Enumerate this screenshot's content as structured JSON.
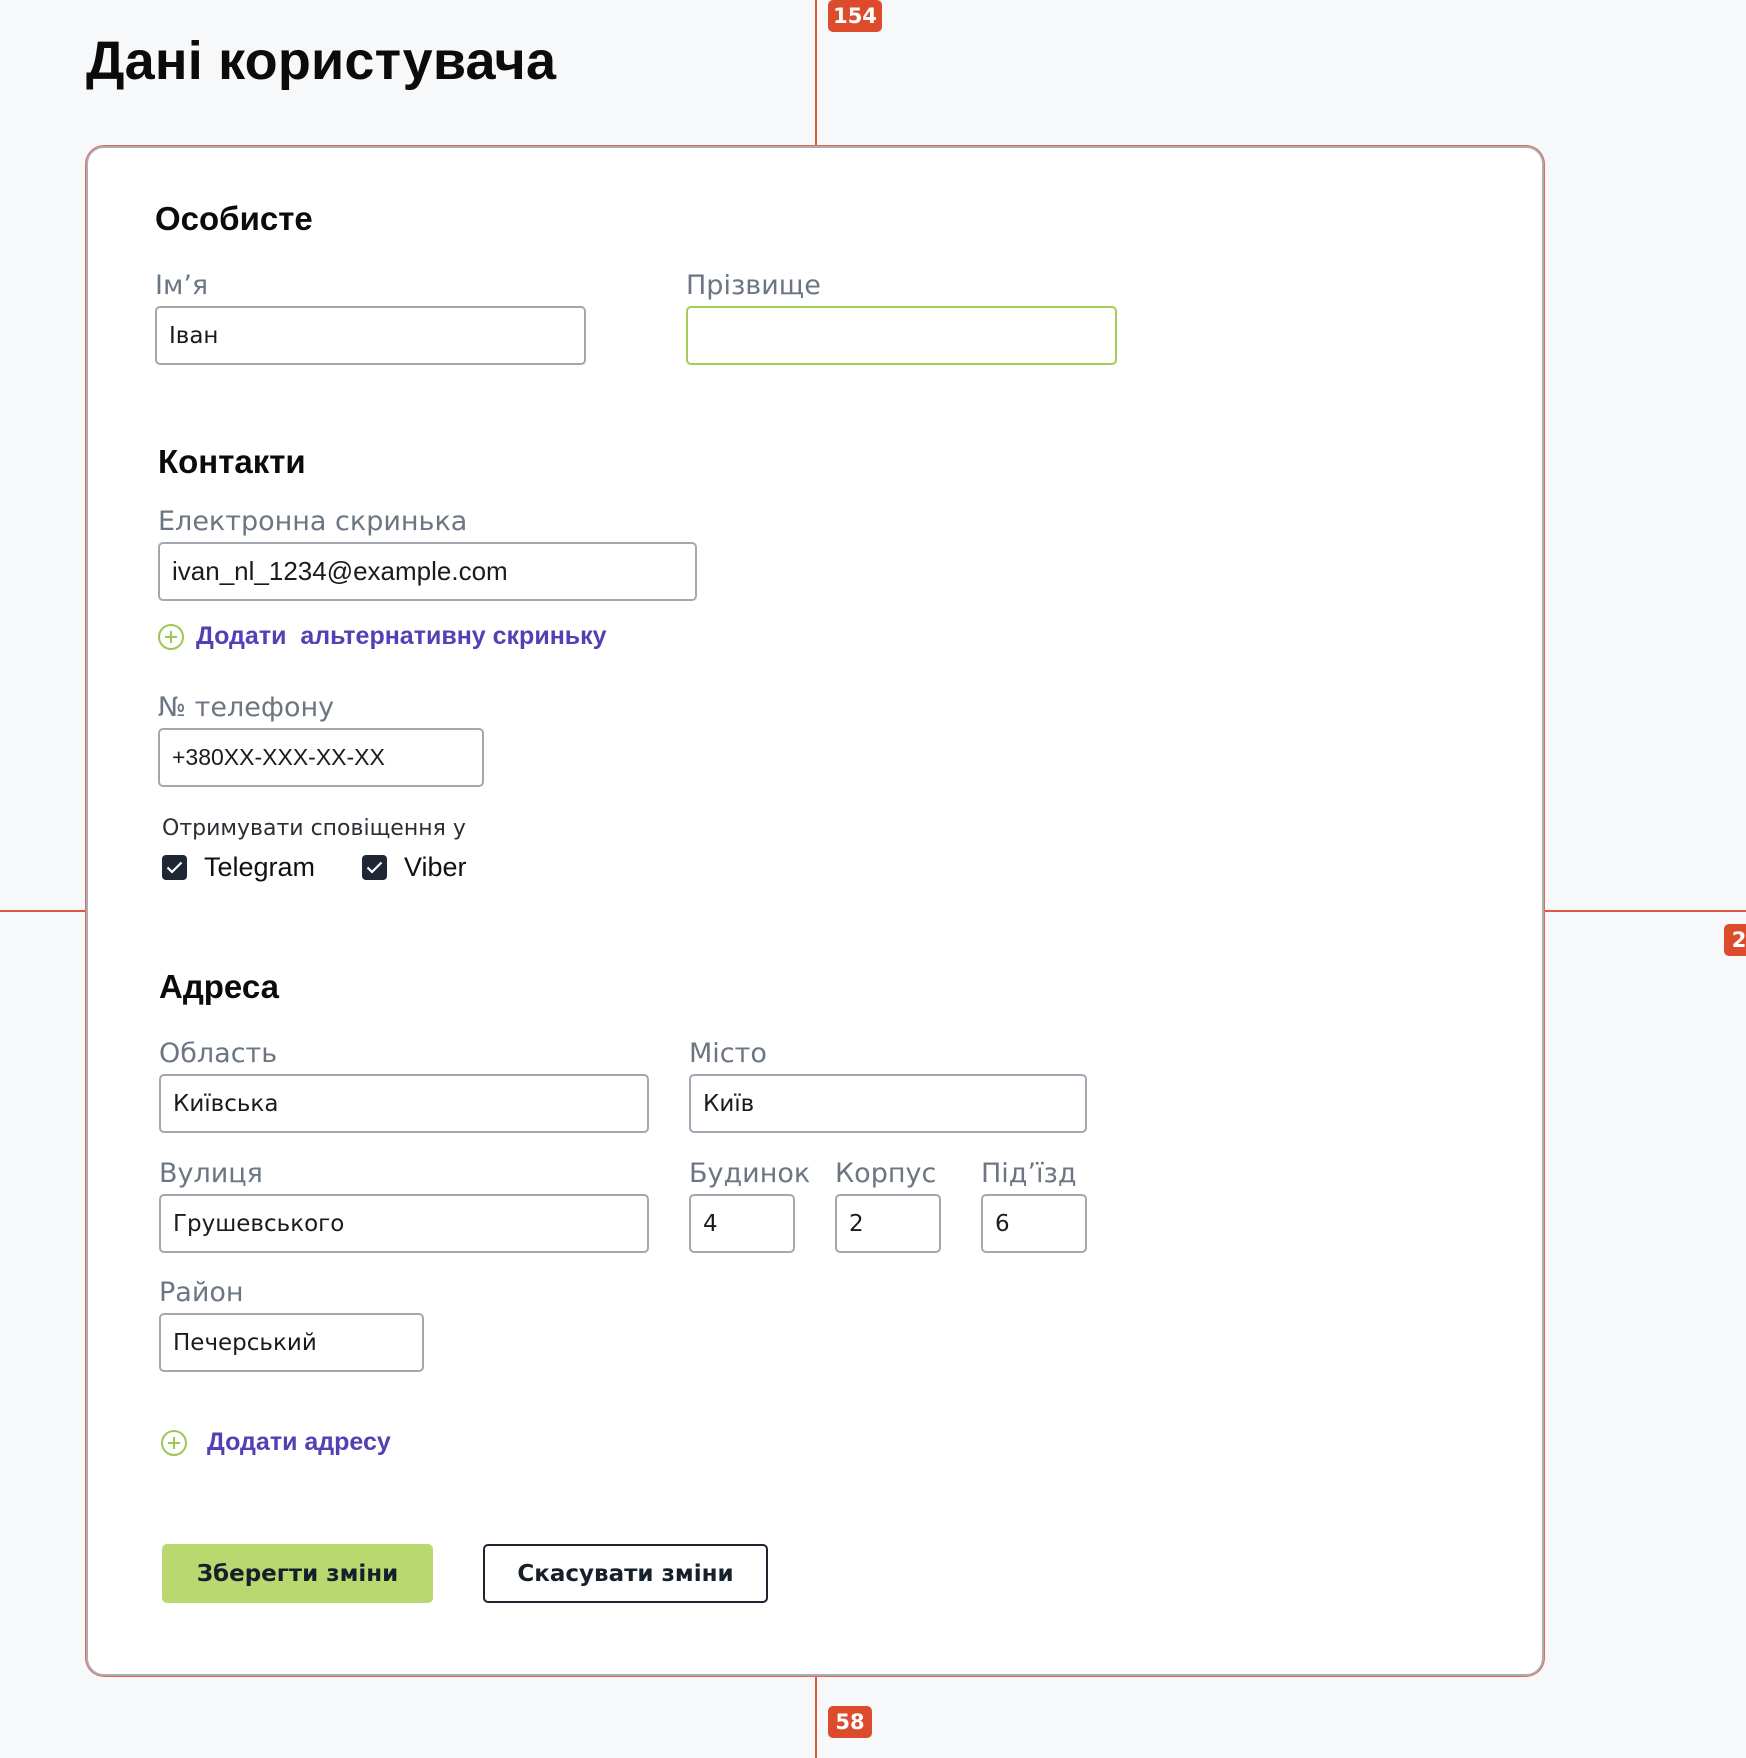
{
  "page": {
    "title": "Дані користувача"
  },
  "guides": {
    "top_gap": "154",
    "bottom_gap": "58",
    "right_gap": "2"
  },
  "personal": {
    "title": "Особисте",
    "first_name": {
      "label": "Ім’я",
      "value": "Іван"
    },
    "last_name": {
      "label": "Прізвище",
      "value": ""
    }
  },
  "contacts": {
    "title": "Контакти",
    "email": {
      "label": "Електронна скринька",
      "value": "ivan_nl_1234@example.com"
    },
    "add_email_label": "Додати  альтернативну скриньку",
    "phone": {
      "label": "№ телефону",
      "value": "+380XX-XXX-XX-XX"
    },
    "notify_label": "Отримувати сповіщення у",
    "notify_options": [
      {
        "label": "Telegram",
        "checked": true
      },
      {
        "label": "Viber",
        "checked": true
      }
    ]
  },
  "address": {
    "title": "Адреса",
    "region": {
      "label": "Область",
      "value": "Київська"
    },
    "city": {
      "label": "Місто",
      "value": "Київ"
    },
    "street": {
      "label": "Вулиця",
      "value": "Грушевського"
    },
    "house": {
      "label": "Будинок",
      "value": "4"
    },
    "building": {
      "label": "Корпус",
      "value": "2"
    },
    "entrance": {
      "label": "Під’їзд",
      "value": "6"
    },
    "district": {
      "label": "Район",
      "value": "Печерський"
    },
    "add_address_label": "Додати адресу"
  },
  "actions": {
    "save_label": "Зберегти зміни",
    "cancel_label": "Скасувати зміни"
  },
  "colors": {
    "accent_green": "#bad870",
    "link_purple": "#5440b5",
    "guide_red": "#dd4b2d"
  }
}
